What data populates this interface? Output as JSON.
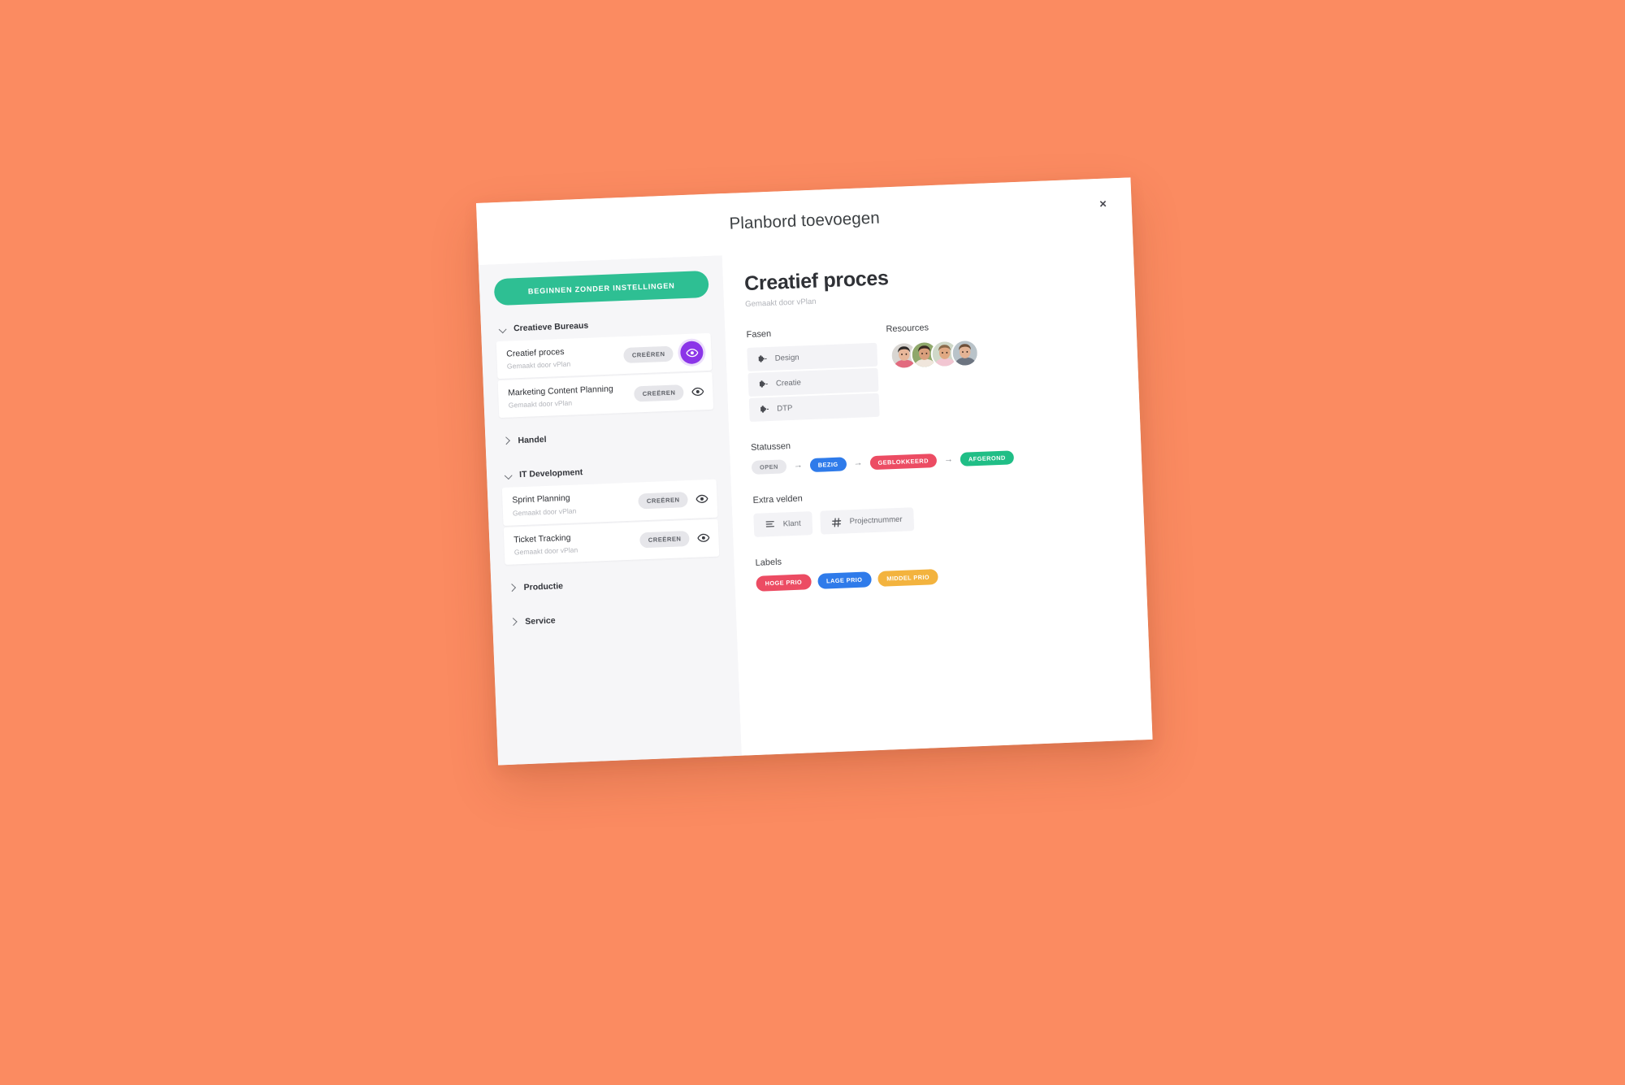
{
  "background_color": "#FB8B61",
  "modal": {
    "title": "Planbord toevoegen",
    "close_label": "×"
  },
  "sidebar": {
    "cta_label": "BEGINNEN ZONDER INSTELLINGEN",
    "groups": [
      {
        "label": "Creatieve Bureaus",
        "expanded": true,
        "items": [
          {
            "name": "Creatief proces",
            "sub": "Gemaakt door vPlan",
            "action_label": "CREËREN",
            "eye_icon": "eye-icon",
            "active": true
          },
          {
            "name": "Marketing Content Planning",
            "sub": "Gemaakt door vPlan",
            "action_label": "CREËREN",
            "eye_icon": "eye-icon",
            "active": false
          }
        ]
      },
      {
        "label": "Handel",
        "expanded": false,
        "items": []
      },
      {
        "label": "IT Development",
        "expanded": true,
        "items": [
          {
            "name": "Sprint Planning",
            "sub": "Gemaakt door vPlan",
            "action_label": "CREËREN",
            "eye_icon": "eye-icon",
            "active": false
          },
          {
            "name": "Ticket Tracking",
            "sub": "Gemaakt door vPlan",
            "action_label": "CREËREN",
            "eye_icon": "eye-icon",
            "active": false
          }
        ]
      },
      {
        "label": "Productie",
        "expanded": false,
        "items": []
      },
      {
        "label": "Service",
        "expanded": false,
        "items": []
      }
    ]
  },
  "panel": {
    "title": "Creatief proces",
    "subtitle": "Gemaakt door vPlan",
    "fasen": {
      "label": "Fasen",
      "items": [
        {
          "name": "Design",
          "icon": "puzzle-piece-icon"
        },
        {
          "name": "Creatie",
          "icon": "puzzle-piece-icon"
        },
        {
          "name": "DTP",
          "icon": "puzzle-piece-icon"
        }
      ]
    },
    "resources": {
      "label": "Resources",
      "avatars": [
        {
          "name": "avatar-1",
          "skin": "#e8b79a",
          "hair": "#2e2a28",
          "shirt": "#e26a7e",
          "bg": "#d9d6d2"
        },
        {
          "name": "avatar-2",
          "skin": "#d99f7c",
          "hair": "#3a2a22",
          "shirt": "#f0e6dc",
          "bg": "#8fa86b"
        },
        {
          "name": "avatar-3",
          "skin": "#e0a882",
          "hair": "#8a6a4a",
          "shirt": "#f2c6d2",
          "bg": "#cfd8c8"
        },
        {
          "name": "avatar-4",
          "skin": "#e3b394",
          "hair": "#6d4f38",
          "shirt": "#6c7480",
          "bg": "#b9c3c9"
        }
      ]
    },
    "statussen": {
      "label": "Statussen",
      "arrow": "→",
      "items": [
        {
          "text": "OPEN",
          "color": "#E8E8EC",
          "text_color": "#74777e"
        },
        {
          "text": "BEZIG",
          "color": "#2F7BEA",
          "text_color": "#ffffff"
        },
        {
          "text": "GEBLOKKEERD",
          "color": "#EC4C63",
          "text_color": "#ffffff"
        },
        {
          "text": "AFGEROND",
          "color": "#20BE86",
          "text_color": "#ffffff"
        }
      ]
    },
    "extra_velden": {
      "label": "Extra velden",
      "items": [
        {
          "name": "Klant",
          "icon": "text-lines-icon"
        },
        {
          "name": "Projectnummer",
          "icon": "hash-icon"
        }
      ]
    },
    "labels": {
      "label": "Labels",
      "items": [
        {
          "text": "HOGE PRIO",
          "color": "#EC4C63"
        },
        {
          "text": "LAGE PRIO",
          "color": "#2F7BEA"
        },
        {
          "text": "MIDDEL PRIO",
          "color": "#F3B33E"
        }
      ]
    }
  }
}
